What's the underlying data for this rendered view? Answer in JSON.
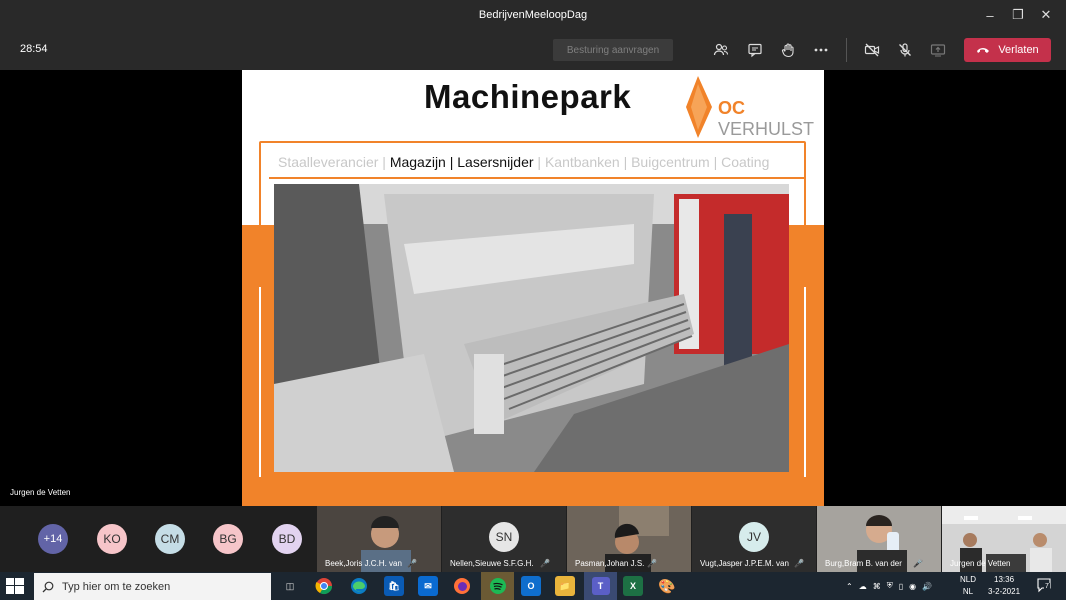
{
  "window": {
    "title": "BedrijvenMeeloopDag",
    "minimize_icon": "minimize-icon",
    "maximize_icon": "restore-icon",
    "close_icon": "close-icon"
  },
  "toolbar": {
    "timer": "28:54",
    "control_button": "Besturing aanvragen",
    "leave_label": "Verlaten",
    "icons": [
      "people-icon",
      "chat-icon",
      "raise-hand-icon",
      "more-icon",
      "camera-off-icon",
      "mic-off-icon",
      "share-icon",
      "phone-icon"
    ],
    "leave_color": "#c4314b"
  },
  "slide": {
    "title": "Machinepark",
    "logo_prefix": "OC",
    "logo_text": "VERHULST",
    "breadcrumb": {
      "before": "Staalleverancier |",
      "active": "Magazijn | Lasersnijder",
      "after": "| Kantbanken | Buigcentrum | Coating"
    },
    "accent_color": "#f1832a"
  },
  "presenter_name": "Jurgen de Vetten",
  "participants": {
    "overflow": "+14",
    "avatars": [
      {
        "initials": "KO",
        "color": "#f6c5c9"
      },
      {
        "initials": "CM",
        "color": "#c5dde6"
      },
      {
        "initials": "BG",
        "color": "#f6c5c9"
      },
      {
        "initials": "BD",
        "color": "#e2d3f0"
      }
    ],
    "tiles": [
      {
        "name": "Beek,Joris J.C.H. van",
        "type": "video"
      },
      {
        "name": "Nellen,Sieuwe S.F.G.H.",
        "type": "avatar",
        "initials": "SN",
        "color": "#e6e6e6"
      },
      {
        "name": "Pasman,Johan J.S.",
        "type": "video"
      },
      {
        "name": "Vugt,Jasper J.P.E.M. van",
        "type": "avatar",
        "initials": "JV",
        "color": "#d6ecec"
      },
      {
        "name": "Burg,Bram B. van der",
        "type": "video"
      },
      {
        "name": "Jurgen de Vetten",
        "type": "video"
      }
    ]
  },
  "taskbar": {
    "search_placeholder": "Typ hier om te zoeken",
    "language": "NLD",
    "language_sub": "NL",
    "time": "13:36",
    "date": "3-2-2021",
    "notification_count": "7",
    "apps": [
      "task-view-icon",
      "chrome-icon",
      "edge-icon",
      "store-icon",
      "mail-icon",
      "firefox-icon",
      "spotify-icon",
      "outlook-icon",
      "explorer-icon",
      "teams-icon",
      "excel-icon",
      "paint-icon"
    ]
  }
}
